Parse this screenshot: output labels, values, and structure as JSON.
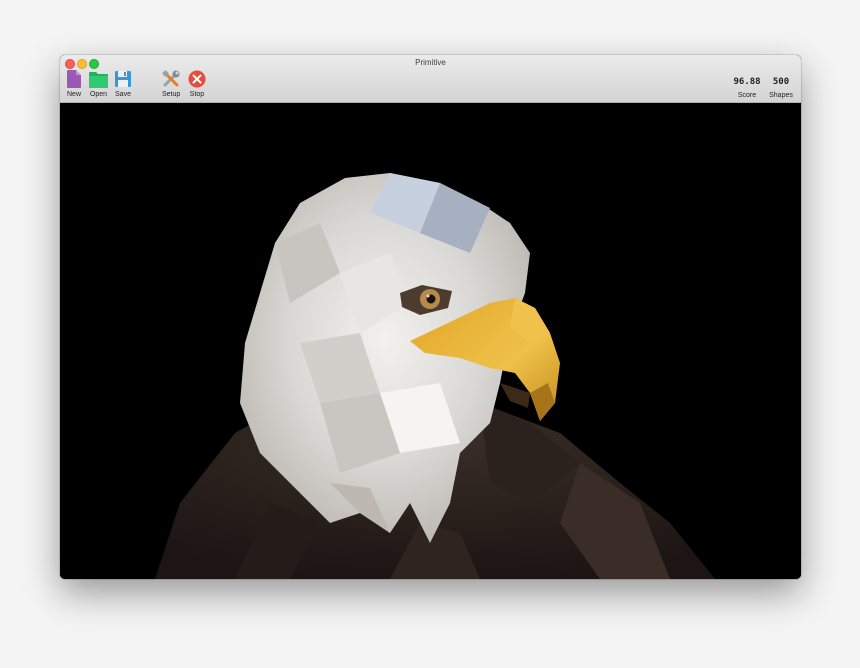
{
  "window": {
    "title": "Primitive"
  },
  "toolbar": {
    "new_label": "New",
    "open_label": "Open",
    "save_label": "Save",
    "setup_label": "Setup",
    "stop_label": "Stop"
  },
  "stats": {
    "score_value": "96.88",
    "score_label": "Score",
    "shapes_value": "500",
    "shapes_label": "Shapes"
  },
  "icons": {
    "new": "document-icon",
    "open": "folder-icon",
    "save": "floppy-disk-icon",
    "setup": "tools-icon",
    "stop": "stop-icon"
  },
  "colors": {
    "new_icon": "#9b59b6",
    "open_icon": "#2ecc71",
    "save_icon": "#3498db",
    "stop_icon": "#e74c3c",
    "canvas_background": "#000000"
  }
}
